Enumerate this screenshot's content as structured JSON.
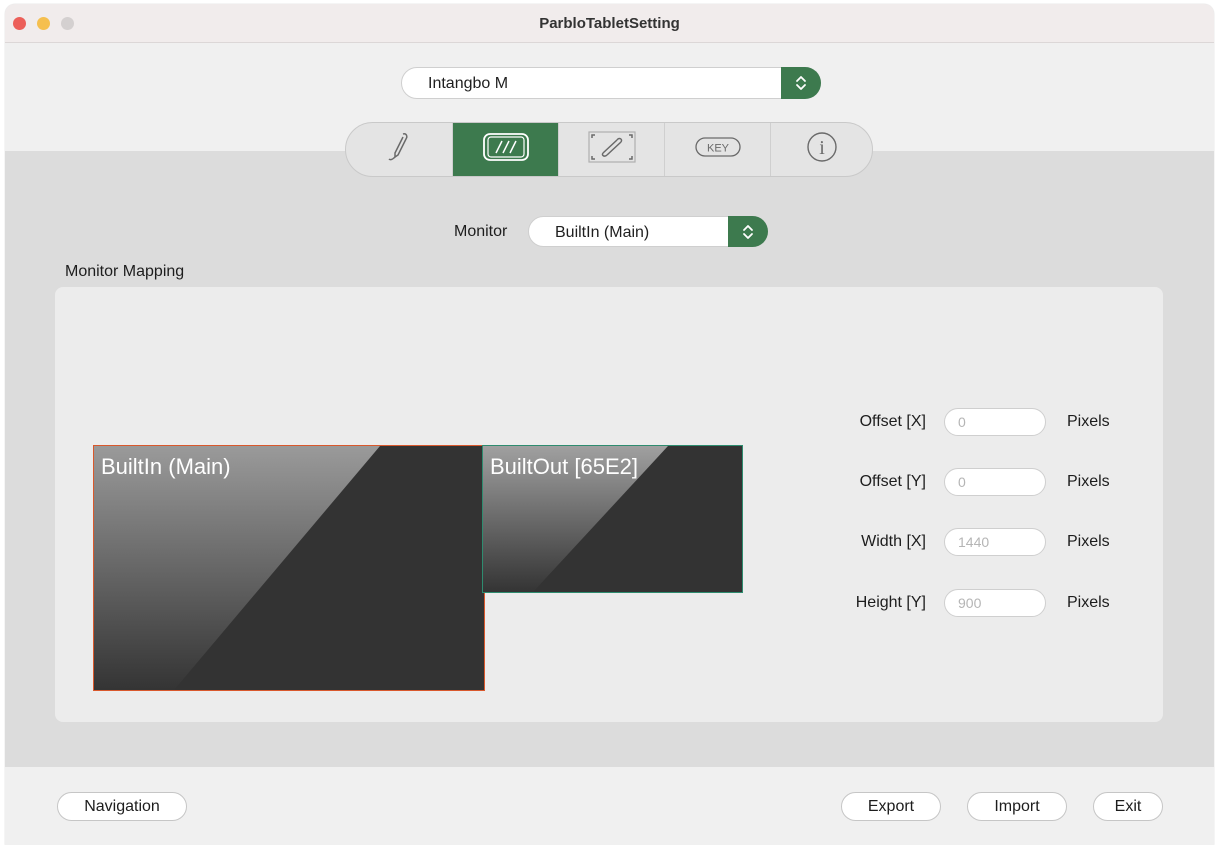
{
  "window": {
    "title": "ParbloTabletSetting"
  },
  "device": {
    "selected": "Intangbo M"
  },
  "tabs": [
    {
      "icon": "pen-icon",
      "active": false
    },
    {
      "icon": "tablet-area-icon",
      "active": true
    },
    {
      "icon": "display-mapping-icon",
      "active": false
    },
    {
      "icon": "key-icon",
      "label": "KEY",
      "active": false
    },
    {
      "icon": "info-icon",
      "label": "i",
      "active": false
    }
  ],
  "monitor": {
    "label": "Monitor",
    "selected": "BuiltIn (Main)"
  },
  "mapping": {
    "section_label": "Monitor Mapping",
    "screens": [
      {
        "label": "BuiltIn (Main)"
      },
      {
        "label": "BuiltOut [65E2]"
      }
    ],
    "fields": [
      {
        "label": "Offset [X]",
        "placeholder": "0",
        "unit": "Pixels"
      },
      {
        "label": "Offset [Y]",
        "placeholder": "0",
        "unit": "Pixels"
      },
      {
        "label": "Width [X]",
        "placeholder": "1440",
        "unit": "Pixels"
      },
      {
        "label": "Height [Y]",
        "placeholder": "900",
        "unit": "Pixels"
      }
    ]
  },
  "footer": {
    "navigation": "Navigation",
    "export": "Export",
    "import": "Import",
    "exit": "Exit"
  },
  "colors": {
    "accent": "#3d7a4e",
    "main_screen_border": "#d9582c",
    "ext_screen_border": "#2e8c6f",
    "screen_fill": "#333333"
  }
}
